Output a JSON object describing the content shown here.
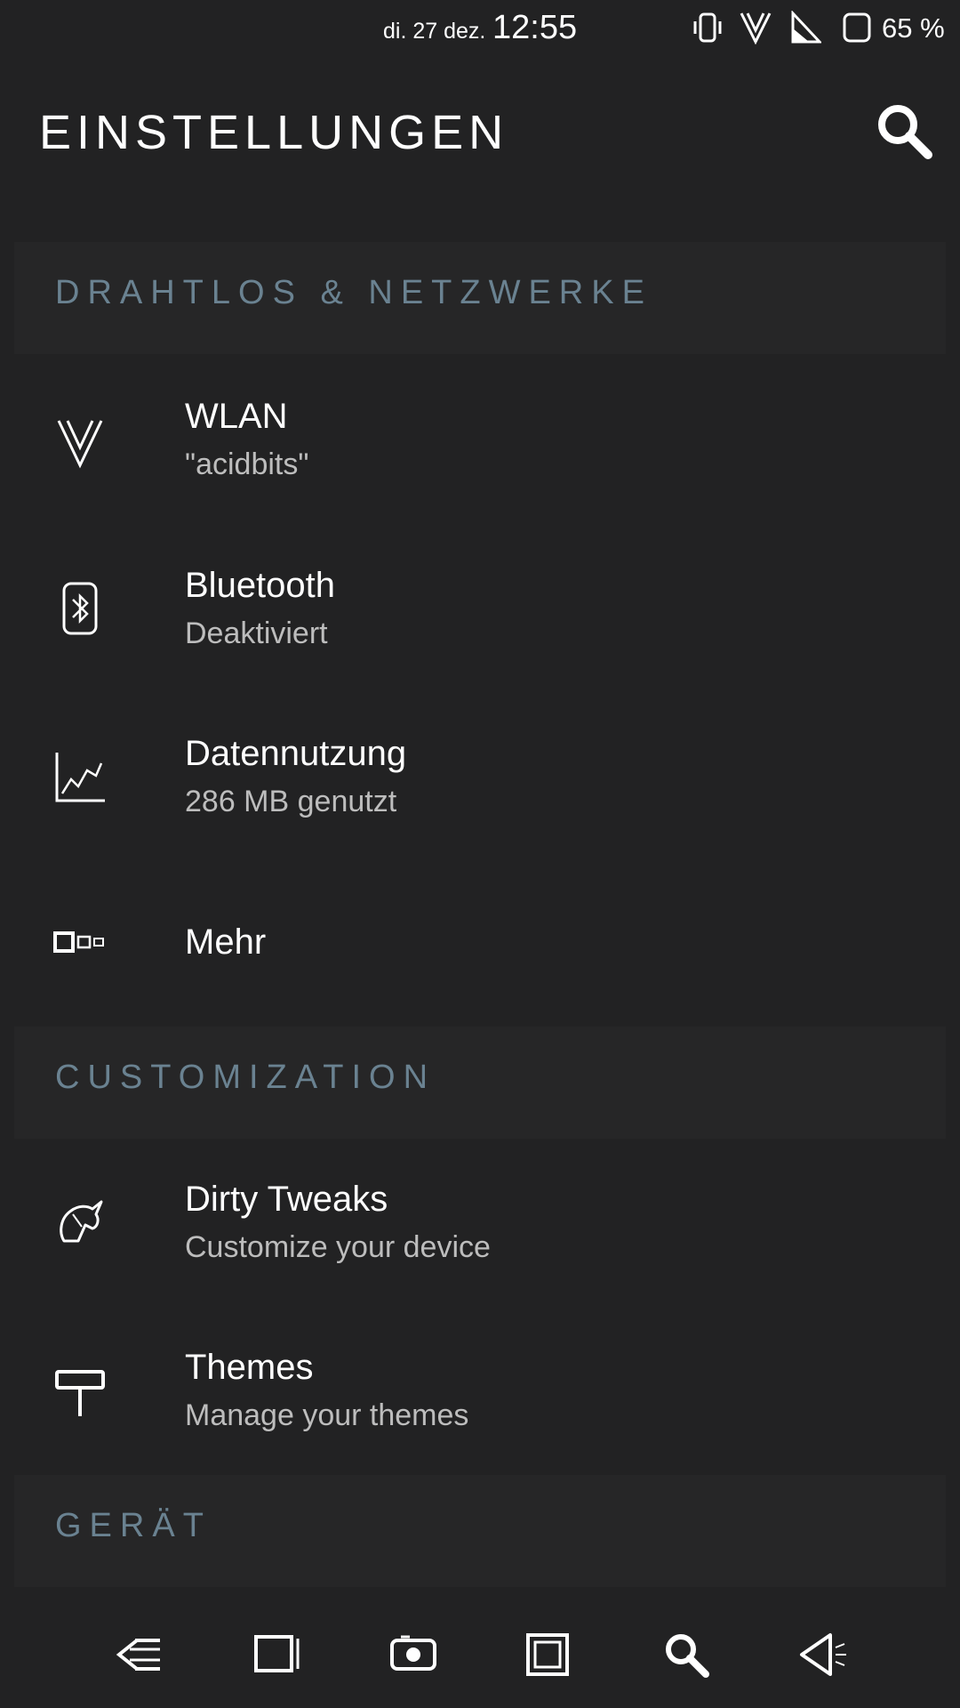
{
  "status_bar": {
    "date": "di. 27 dez.",
    "time": "12:55",
    "battery_percent": "65 %",
    "icons": [
      "vibrate-icon",
      "wifi-signal-icon",
      "cell-signal-icon",
      "battery-icon"
    ]
  },
  "header": {
    "title": "EINSTELLUNGEN",
    "search_icon": "search-icon"
  },
  "sections": {
    "wireless": {
      "label": "DRAHTLOS & NETZWERKE",
      "items": {
        "wlan": {
          "title": "WLAN",
          "subtitle": "\"acidbits\"",
          "icon": "wifi-icon"
        },
        "bluetooth": {
          "title": "Bluetooth",
          "subtitle": "Deaktiviert",
          "icon": "bluetooth-icon"
        },
        "data": {
          "title": "Datennutzung",
          "subtitle": "286 MB genutzt",
          "icon": "data-usage-icon"
        },
        "more": {
          "title": "Mehr",
          "icon": "more-icon"
        }
      }
    },
    "customization": {
      "label": "CUSTOMIZATION",
      "items": {
        "tweaks": {
          "title": "Dirty Tweaks",
          "subtitle": "Customize your device",
          "icon": "unicorn-icon"
        },
        "themes": {
          "title": "Themes",
          "subtitle": "Manage your themes",
          "icon": "paint-roller-icon"
        }
      }
    },
    "device": {
      "label": "GERÄT"
    }
  },
  "nav_bar": {
    "buttons": [
      "menu-icon",
      "recents-icon",
      "screenshot-icon",
      "home-icon",
      "search-icon",
      "back-icon"
    ]
  },
  "colors": {
    "background": "#222223",
    "section_background": "#262627",
    "section_label": "#6a8291",
    "subtitle": "#bdbdbd"
  }
}
